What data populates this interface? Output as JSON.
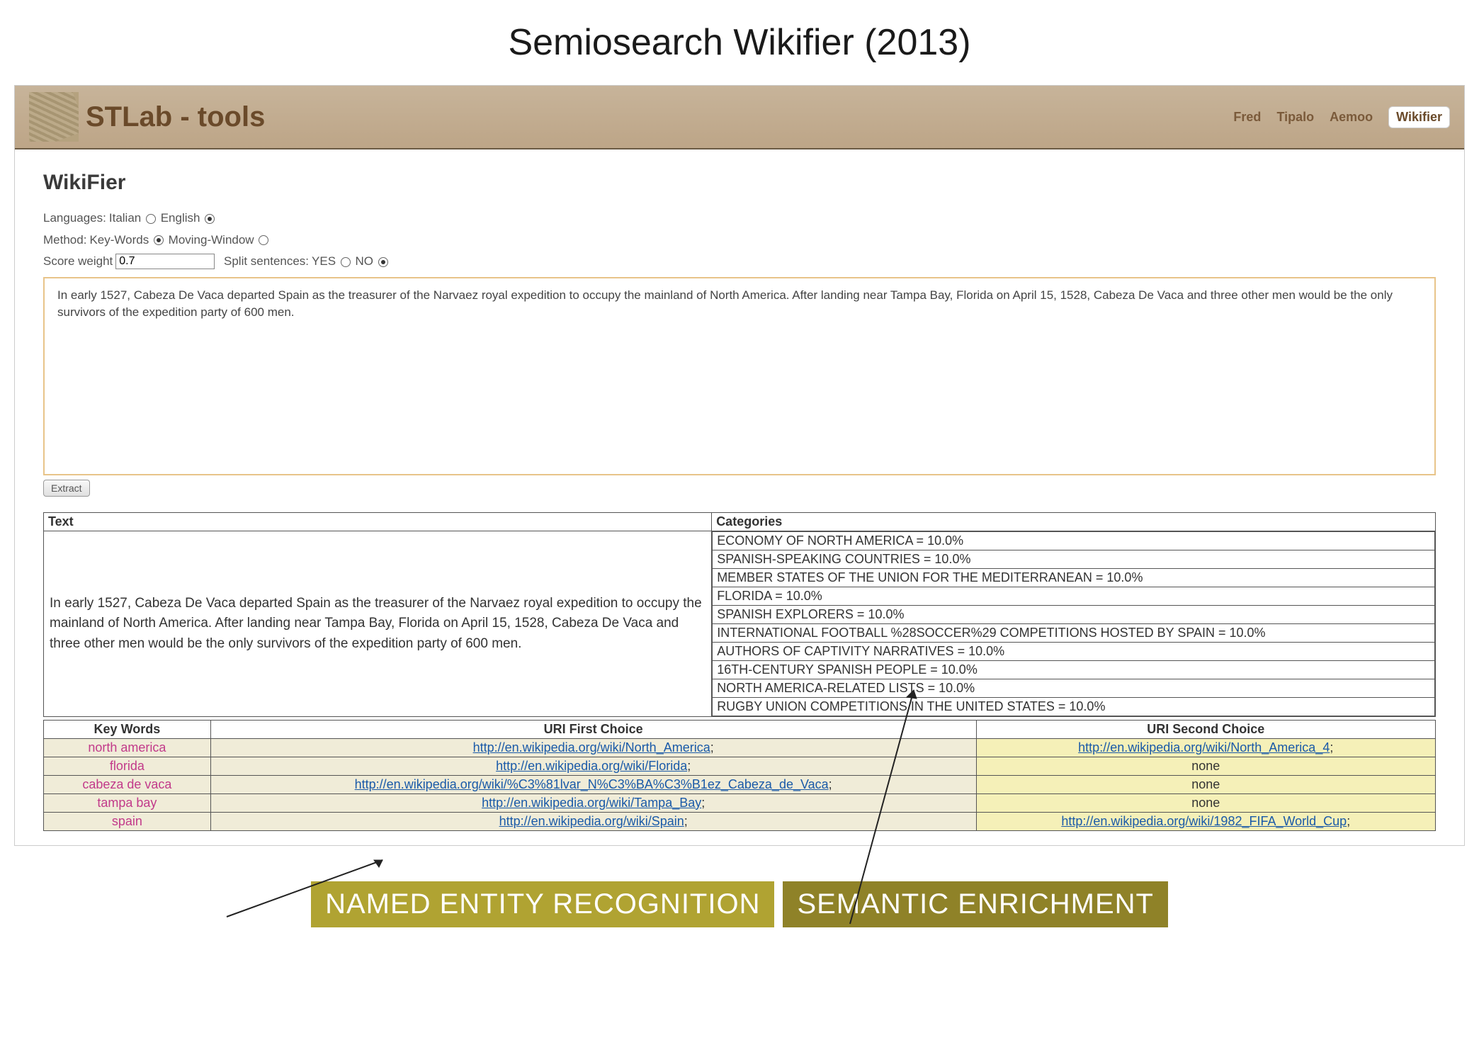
{
  "slide_title": "Semiosearch Wikifier (2013)",
  "header": {
    "brand": "STLab - tools",
    "nav": [
      "Fred",
      "Tipalo",
      "Aemoo",
      "Wikifier"
    ],
    "active": "Wikifier"
  },
  "page_title": "WikiFier",
  "settings": {
    "languages_label": "Languages:",
    "lang_opts": [
      "Italian",
      "English"
    ],
    "lang_selected": "English",
    "method_label": "Method:",
    "method_opts": [
      "Key-Words",
      "Moving-Window"
    ],
    "method_selected": "Key-Words",
    "score_label": "Score weight",
    "score_value": "0.7",
    "split_label": "Split sentences:",
    "split_opts": [
      "YES",
      "NO"
    ],
    "split_selected": "NO"
  },
  "input_text": "In early 1527, Cabeza De Vaca departed Spain as the treasurer of the Narvaez royal expedition to occupy the mainland of North America. After landing near Tampa Bay, Florida on April 15, 1528, Cabeza De Vaca and three other men would be the only survivors of the expedition party of 600 men.",
  "extract_label": "Extract",
  "results": {
    "headers": {
      "text": "Text",
      "categories": "Categories"
    },
    "text": "In early 1527, Cabeza De Vaca departed Spain as the treasurer of the Narvaez royal expedition to occupy the mainland of North America. After landing near Tampa Bay, Florida on April 15, 1528, Cabeza De Vaca and three other men would be the only survivors of the expedition party of 600 men.",
    "categories": [
      "ECONOMY OF NORTH AMERICA = 10.0%",
      "SPANISH-SPEAKING COUNTRIES = 10.0%",
      "MEMBER STATES OF THE UNION FOR THE MEDITERRANEAN = 10.0%",
      "FLORIDA = 10.0%",
      "SPANISH EXPLORERS = 10.0%",
      "INTERNATIONAL FOOTBALL %28SOCCER%29 COMPETITIONS HOSTED BY SPAIN = 10.0%",
      "AUTHORS OF CAPTIVITY NARRATIVES = 10.0%",
      "16TH-CENTURY SPANISH PEOPLE = 10.0%",
      "NORTH AMERICA-RELATED LISTS = 10.0%",
      "RUGBY UNION COMPETITIONS IN THE UNITED STATES = 10.0%"
    ],
    "kw_headers": {
      "kw": "Key Words",
      "u1": "URI First Choice",
      "u2": "URI Second Choice"
    },
    "keywords": [
      {
        "kw": "north america",
        "u1": "http://en.wikipedia.org/wiki/North_America",
        "u2": "http://en.wikipedia.org/wiki/North_America_4"
      },
      {
        "kw": "florida",
        "u1": "http://en.wikipedia.org/wiki/Florida",
        "u2": "none"
      },
      {
        "kw": "cabeza de vaca",
        "u1": "http://en.wikipedia.org/wiki/%C3%81lvar_N%C3%BA%C3%B1ez_Cabeza_de_Vaca",
        "u2": "none"
      },
      {
        "kw": "tampa bay",
        "u1": "http://en.wikipedia.org/wiki/Tampa_Bay",
        "u2": "none"
      },
      {
        "kw": "spain",
        "u1": "http://en.wikipedia.org/wiki/Spain",
        "u2": "http://en.wikipedia.org/wiki/1982_FIFA_World_Cup"
      }
    ]
  },
  "annotation_labels": {
    "ner": "NAMED ENTITY RECOGNITION",
    "sem": "SEMANTIC ENRICHMENT"
  }
}
